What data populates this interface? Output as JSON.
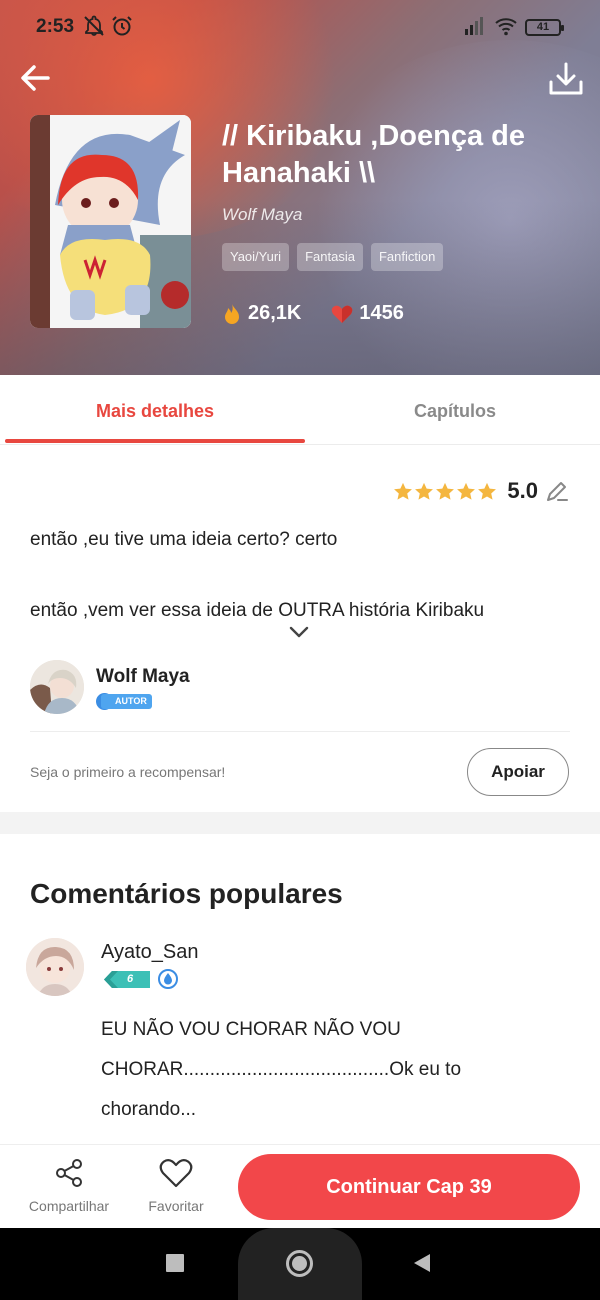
{
  "status_bar": {
    "time": "2:53",
    "battery": "41",
    "icons": [
      "notifications-off-icon",
      "alarm-icon",
      "signal-icon",
      "wifi-icon",
      "battery-icon"
    ]
  },
  "header": {
    "back_icon": "arrow-left-icon",
    "download_icon": "download-icon",
    "title": "// Kiribaku ,Doença de Hanahaki \\\\",
    "author": "Wolf Maya",
    "tags": [
      "Yaoi/Yuri",
      "Fantasia",
      "Fanfiction"
    ],
    "views": "26,1K",
    "likes": "1456",
    "views_icon": "flame-icon",
    "likes_icon": "heart-vote-icon"
  },
  "tabs": [
    {
      "label": "Mais detalhes",
      "active": true
    },
    {
      "label": "Capítulos",
      "active": false
    }
  ],
  "details": {
    "rating": "5.0",
    "stars": 5,
    "description_lines": [
      "então ,eu tive uma ideia certo? certo",
      "então ,vem ver essa ideia de OUTRA história Kiribaku"
    ],
    "author_name": "Wolf Maya",
    "author_badge": "AUTOR",
    "reward_text": "Seja o primeiro a recompensar!",
    "support_label": "Apoiar"
  },
  "comments": {
    "title": "Comentários populares",
    "items": [
      {
        "user": "Ayato_San",
        "level": "6",
        "text": "EU NÃO VOU CHORAR NÃO VOU CHORAR.......................................Ok eu to chorando..."
      }
    ]
  },
  "bottom_bar": {
    "share_label": "Compartilhar",
    "favorite_label": "Favoritar",
    "continue_label": "Continuar Cap 39"
  },
  "colors": {
    "accent": "#e8473f",
    "button": "#f2474a",
    "star": "#f4b63f",
    "badge_blue": "#4fa5ef",
    "level_teal": "#3cc0b6"
  }
}
